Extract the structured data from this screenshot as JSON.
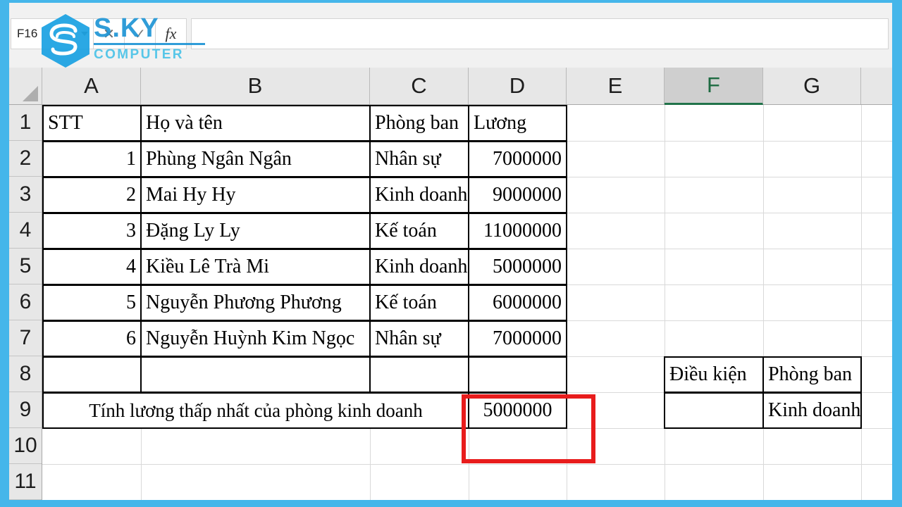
{
  "window": {
    "frame_color": "#45b6ea"
  },
  "formula_bar": {
    "name_box_value": "F16",
    "name_box_icon": "chevron-down-icon",
    "cancel_label": "✕",
    "enter_label": "✓",
    "fx_label": "fx",
    "formula_value": "",
    "formula_placeholder": ""
  },
  "grid": {
    "columns": [
      "A",
      "B",
      "C",
      "D",
      "E",
      "F",
      "G"
    ],
    "selected_column": "F",
    "rows": [
      "1",
      "2",
      "3",
      "4",
      "5",
      "6",
      "7",
      "8",
      "9",
      "10",
      "11"
    ]
  },
  "sheet": {
    "headers": {
      "a1": "STT",
      "b1": "Họ và tên",
      "c1": "Phòng ban",
      "d1": "Lương"
    },
    "data_rows": [
      {
        "stt": "1",
        "name": "Phùng Ngân Ngân",
        "dept": "Nhân sự",
        "salary": "7000000"
      },
      {
        "stt": "2",
        "name": "Mai Hy Hy",
        "dept": "Kinh doanh",
        "salary": "9000000"
      },
      {
        "stt": "3",
        "name": "Đặng Ly Ly",
        "dept": "Kế toán",
        "salary": "11000000"
      },
      {
        "stt": "4",
        "name": "Kiều Lê Trà Mi",
        "dept": "Kinh doanh",
        "salary": "5000000"
      },
      {
        "stt": "5",
        "name": "Nguyễn Phương Phương",
        "dept": "Kế toán",
        "salary": "6000000"
      },
      {
        "stt": "6",
        "name": "Nguyễn Huỳnh Kim Ngọc",
        "dept": "Nhân sự",
        "salary": "7000000"
      }
    ],
    "blank_row": {
      "stt": "",
      "name": "",
      "dept": "",
      "salary": ""
    },
    "result_row": {
      "label": "Tính lương thấp nhất của phòng kinh doanh",
      "value": "5000000"
    },
    "criteria_table": {
      "f8": "Điều kiện",
      "g8": "Phòng ban",
      "f9": "",
      "g9": "Kinh doanh"
    }
  },
  "annotation": {
    "highlight_color": "#e81c1c",
    "target": "D9"
  },
  "watermark": {
    "brand": "S.KY",
    "subtitle": "COMPUTER",
    "logo_icon": "sky-hexagon-logo-icon",
    "color_primary": "#2196d6",
    "color_secondary": "#4cc3e8"
  }
}
